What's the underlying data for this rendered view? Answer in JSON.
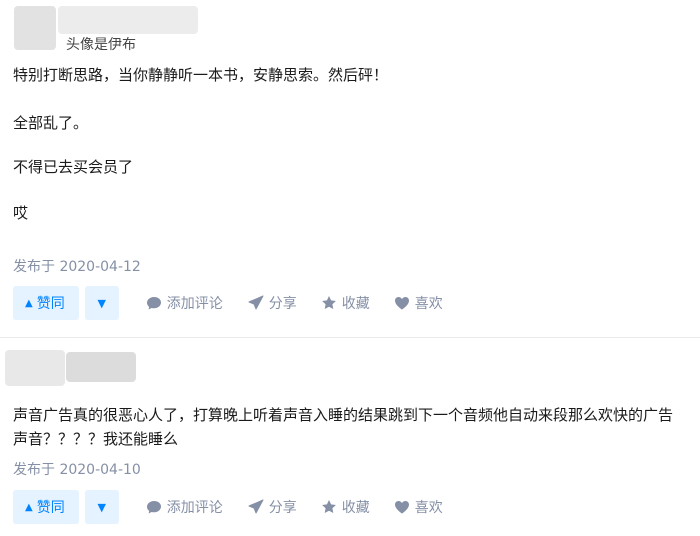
{
  "answers": [
    {
      "author": "头像是伊布",
      "paragraphs": [
        "特别打断思路，当你静静听一本书，安静思索。然后砰！",
        "全部乱了。",
        "不得已去买会员了",
        "哎"
      ],
      "date": "发布于 2020-04-12"
    },
    {
      "author": "",
      "paragraphs": [
        "声音广告真的很恶心人了，打算晚上听着声音入睡的结果跳到下一个音频他自动来段那么欢快的广告声音？？？？我还能睡么"
      ],
      "date": "发布于 2020-04-10"
    }
  ],
  "actions": {
    "vote_up_icon": "▲",
    "vote_up": "赞同",
    "vote_down_icon": "▼",
    "comment": "添加评论",
    "share": "分享",
    "favorite": "收藏",
    "like": "喜欢"
  },
  "colors": {
    "accent": "#0084ff",
    "accent_bg": "#e5f2ff",
    "meta": "#8590a6"
  }
}
